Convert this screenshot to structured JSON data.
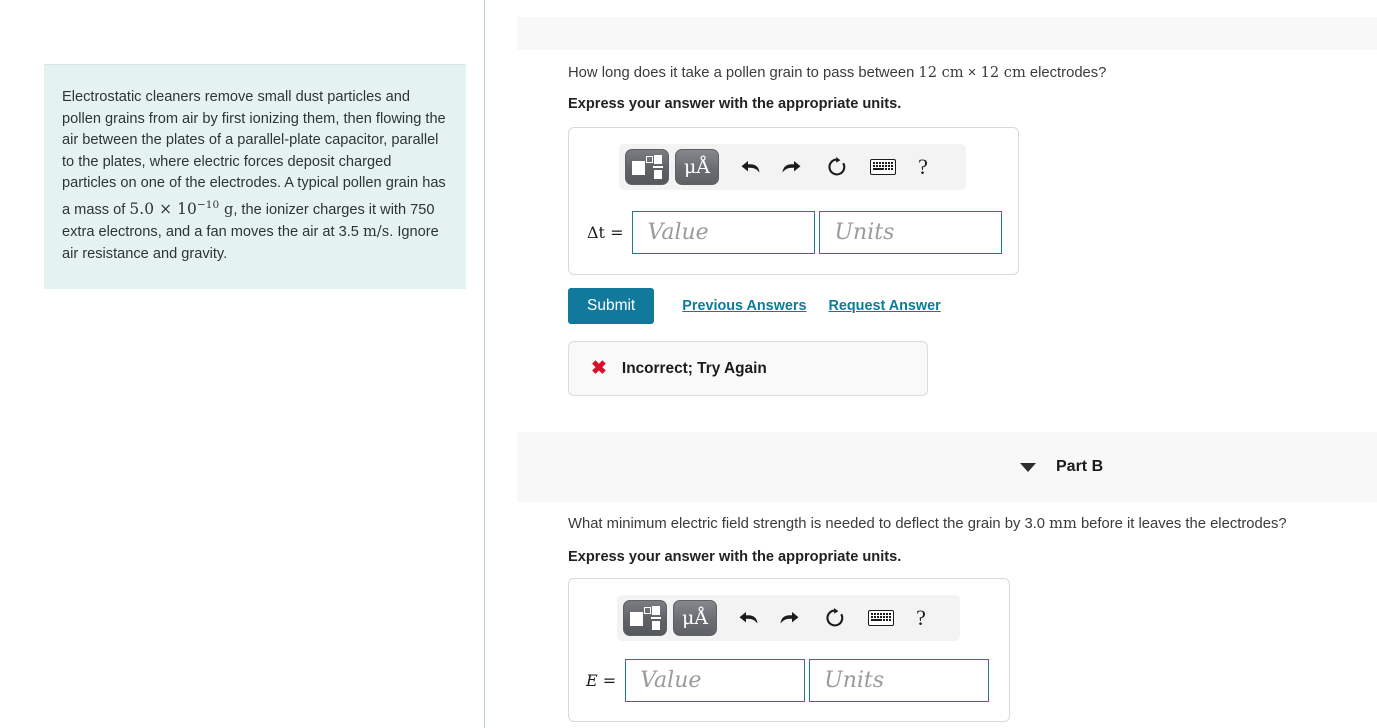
{
  "problem": {
    "text_part1": "Electrostatic cleaners remove small dust particles and pollen grains from air by first ionizing them, then flowing the air between the plates of a parallel-plate capacitor, parallel to the plates, where electric forces deposit charged particles on one of the electrodes. A typical pollen grain has a mass of ",
    "mass_value": "5.0 × 10",
    "mass_exponent": "−10",
    "mass_unit": "g",
    "text_part2": ", the ionizer charges it with 750 extra electrons, and a fan moves the air at 3.5 ",
    "speed_unit": "m/s",
    "text_part3": ". Ignore air resistance and gravity."
  },
  "part_a": {
    "question_pre": "How long does it take a pollen grain to pass between ",
    "question_dim1": "12 cm",
    "question_times": "×",
    "question_dim2": "12 cm",
    "question_post": " electrodes?",
    "instruction": "Express your answer with the appropriate units.",
    "variable_label": "Δt",
    "equals": "=",
    "value_placeholder": "Value",
    "units_placeholder": "Units",
    "value_current": "",
    "units_current": "",
    "submit_label": "Submit",
    "previous_answers_label": "Previous Answers",
    "request_answer_label": "Request Answer",
    "feedback_icon": "x-mark",
    "feedback_text": "Incorrect; Try Again"
  },
  "part_b": {
    "header_label": "Part B",
    "question_pre": "What minimum electric field strength is needed to deflect the grain by 3.0 ",
    "question_unit": "mm",
    "question_post": " before it leaves the electrodes?",
    "instruction": "Express your answer with the appropriate units.",
    "variable_label": "E",
    "equals": "=",
    "value_placeholder": "Value",
    "units_placeholder": "Units",
    "value_current": "",
    "units_current": ""
  },
  "toolbar": {
    "template_button_title": "math-template",
    "units_button_label": "μÅ",
    "undo_title": "undo",
    "redo_title": "redo",
    "reset_title": "reset",
    "keyboard_title": "keyboard",
    "help_label": "?"
  },
  "colors": {
    "accent_teal": "#10799c",
    "field_border": "#1f7a8c",
    "problem_bg": "#e4f3f2",
    "band_bg": "#f8f8f8",
    "error_red": "#d81028",
    "divider": "#bdd2dc"
  }
}
